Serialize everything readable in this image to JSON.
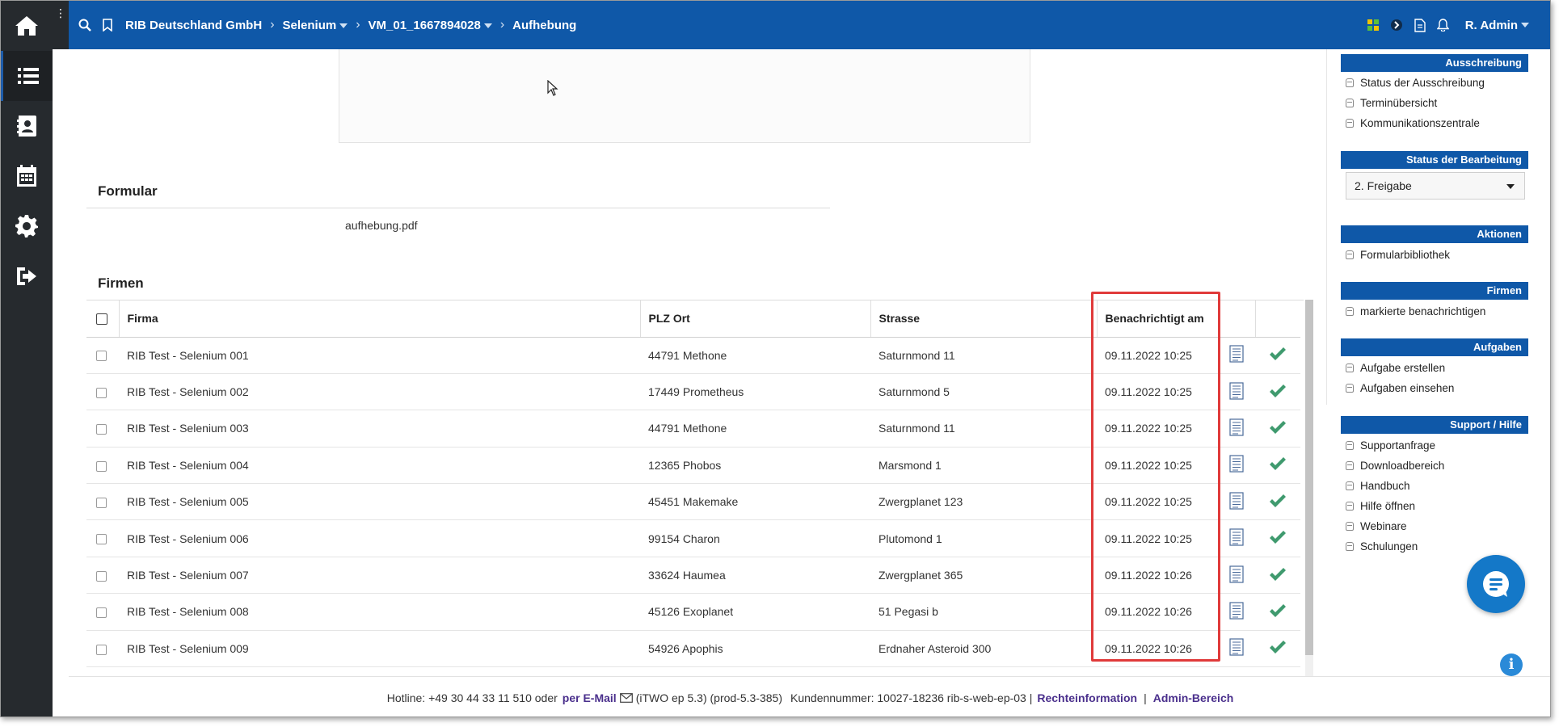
{
  "breadcrumb": {
    "company": "RIB Deutschland GmbH",
    "project": "Selenium",
    "vergabe": "VM_01_1667894028",
    "current": "Aufhebung"
  },
  "user": {
    "name": "R. Admin"
  },
  "sections": {
    "formular_title": "Formular",
    "formular_file": "aufhebung.pdf",
    "firmen_title": "Firmen"
  },
  "table": {
    "headers": {
      "firma": "Firma",
      "plz_ort": "PLZ Ort",
      "strasse": "Strasse",
      "benachrichtigt": "Benachrichtigt am"
    },
    "rows": [
      {
        "firma": "RIB Test - Selenium 001",
        "plz_ort": "44791 Methone",
        "strasse": "Saturnmond 11",
        "date": "09.11.2022 10:25"
      },
      {
        "firma": "RIB Test - Selenium 002",
        "plz_ort": "17449 Prometheus",
        "strasse": "Saturnmond 5",
        "date": "09.11.2022 10:25"
      },
      {
        "firma": "RIB Test - Selenium 003",
        "plz_ort": "44791 Methone",
        "strasse": "Saturnmond 11",
        "date": "09.11.2022 10:25"
      },
      {
        "firma": "RIB Test - Selenium 004",
        "plz_ort": "12365 Phobos",
        "strasse": "Marsmond 1",
        "date": "09.11.2022 10:25"
      },
      {
        "firma": "RIB Test - Selenium 005",
        "plz_ort": "45451 Makemake",
        "strasse": "Zwergplanet 123",
        "date": "09.11.2022 10:25"
      },
      {
        "firma": "RIB Test - Selenium 006",
        "plz_ort": "99154 Charon",
        "strasse": "Plutomond 1",
        "date": "09.11.2022 10:25"
      },
      {
        "firma": "RIB Test - Selenium 007",
        "plz_ort": "33624 Haumea",
        "strasse": "Zwergplanet 365",
        "date": "09.11.2022 10:26"
      },
      {
        "firma": "RIB Test - Selenium 008",
        "plz_ort": "45126 Exoplanet",
        "strasse": "51 Pegasi b",
        "date": "09.11.2022 10:26"
      },
      {
        "firma": "RIB Test - Selenium 009",
        "plz_ort": "54926 Apophis",
        "strasse": "Erdnaher Asteroid 300",
        "date": "09.11.2022 10:26"
      }
    ]
  },
  "right_panel": {
    "ausschreibung": {
      "title": "Ausschreibung",
      "items": [
        "Status der Ausschreibung",
        "Terminübersicht",
        "Kommunikationszentrale"
      ]
    },
    "status": {
      "title": "Status der Bearbeitung",
      "selected": "2. Freigabe"
    },
    "aktionen": {
      "title": "Aktionen",
      "items": [
        "Formularbibliothek"
      ]
    },
    "firmen": {
      "title": "Firmen",
      "items": [
        "markierte benachrichtigen"
      ]
    },
    "aufgaben": {
      "title": "Aufgaben",
      "items": [
        "Aufgabe erstellen",
        "Aufgaben einsehen"
      ]
    },
    "support": {
      "title": "Support / Hilfe",
      "items": [
        "Supportanfrage",
        "Downloadbereich",
        "Handbuch",
        "Hilfe öffnen",
        "Webinare",
        "Schulungen"
      ]
    }
  },
  "footer": {
    "hotline": "Hotline: +49 30 44 33 11 510 oder",
    "email_link": "per E-Mail",
    "version": "(iTWO ep 5.3) (prod-5.3-385)",
    "kunde": "Kundennummer: 10027-18236 rib-s-web-ep-03 |",
    "rechte_link": "Rechteinformation",
    "sep": "|",
    "admin_link": "Admin-Bereich"
  },
  "colors": {
    "brand_blue": "#0f58a8",
    "sidebar": "#262a2e",
    "check_green": "#3f9a6e",
    "highlight_red": "#e03a3a",
    "link_purple": "#4a2f8c"
  },
  "icons": {
    "sidebar": [
      "home-icon",
      "list-icon",
      "contacts-icon",
      "calendar-icon",
      "gear-icon",
      "logout-icon"
    ],
    "topbar": [
      "search-icon",
      "bookmark-icon",
      "apps-icon",
      "arrow-icon",
      "document-icon",
      "bell-icon"
    ],
    "row": [
      "document-icon",
      "checkmark-icon"
    ]
  }
}
